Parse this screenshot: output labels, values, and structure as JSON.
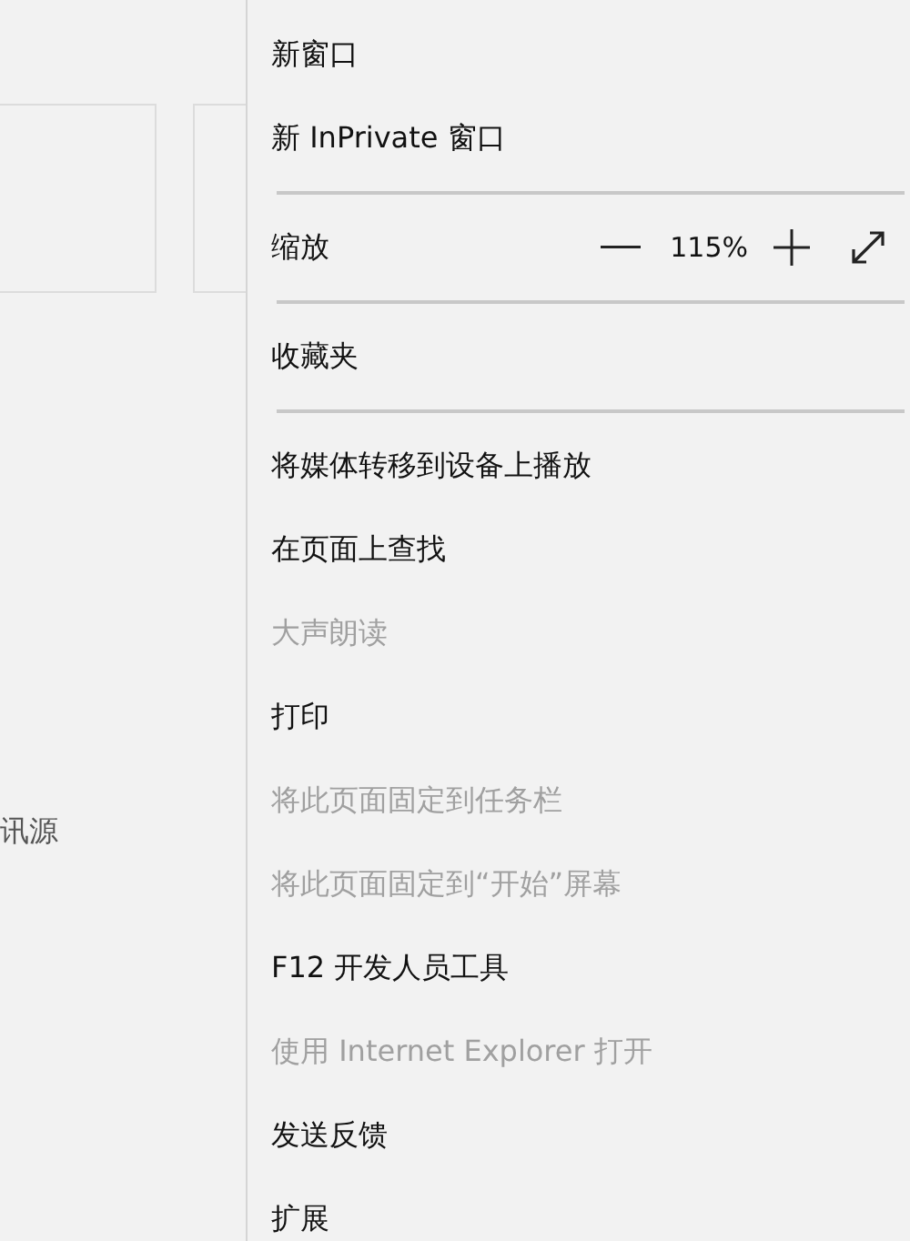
{
  "background": {
    "cards": [
      {
        "kind": "card"
      },
      {
        "kind": "card"
      }
    ],
    "text": "讯源"
  },
  "menu": {
    "items": [
      {
        "kind": "item",
        "label": "新窗口",
        "disabled": false
      },
      {
        "kind": "item",
        "label": "新 InPrivate 窗口",
        "disabled": false
      },
      {
        "kind": "divider"
      },
      {
        "kind": "zoom",
        "label": "缩放",
        "value": "115%",
        "disabled": false
      },
      {
        "kind": "divider"
      },
      {
        "kind": "item",
        "label": "收藏夹",
        "disabled": false
      },
      {
        "kind": "divider"
      },
      {
        "kind": "item",
        "label": "将媒体转移到设备上播放",
        "disabled": false
      },
      {
        "kind": "item",
        "label": "在页面上查找",
        "disabled": false
      },
      {
        "kind": "item",
        "label": "大声朗读",
        "disabled": true
      },
      {
        "kind": "item",
        "label": "打印",
        "disabled": false
      },
      {
        "kind": "item",
        "label": "将此页面固定到任务栏",
        "disabled": true
      },
      {
        "kind": "item",
        "label": "将此页面固定到“开始”屏幕",
        "disabled": true
      },
      {
        "kind": "item",
        "label": "F12 开发人员工具",
        "disabled": false
      },
      {
        "kind": "item",
        "label": "使用 Internet Explorer 打开",
        "disabled": true
      },
      {
        "kind": "item",
        "label": "发送反馈",
        "disabled": false
      },
      {
        "kind": "item",
        "label": "扩展",
        "disabled": false
      }
    ]
  }
}
